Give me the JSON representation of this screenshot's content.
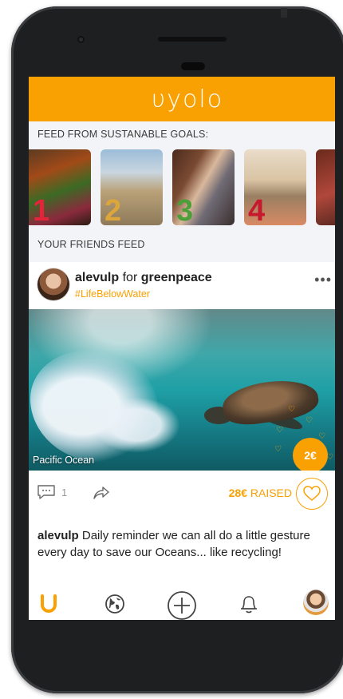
{
  "header": {
    "logo_text": "υyolo"
  },
  "goals_section": {
    "label": "FEED FROM SUSTANABLE GOALS:",
    "goals": [
      {
        "number": "1",
        "color": "#e5243b"
      },
      {
        "number": "2",
        "color": "#dda63a"
      },
      {
        "number": "3",
        "color": "#4c9f38"
      },
      {
        "number": "4",
        "color": "#c5192d"
      },
      {
        "number": "",
        "color": "#ff3a21"
      }
    ]
  },
  "friends_section": {
    "label": "YOUR FRIENDS FEED"
  },
  "post": {
    "username": "alevulp",
    "connector": "for",
    "org": "greenpeace",
    "hashtag": "#LifeBelowWater",
    "more": "•••",
    "photo_caption": "Pacific Ocean",
    "donate_amount": "2€",
    "comment_count": "1",
    "raised_amount": "28€",
    "raised_label": "RAISED",
    "caption_user": "alevulp",
    "caption_text": " Daily reminder we can all do a little gesture every day to save our Oceans... like recycling!"
  },
  "tabbar": {
    "items": [
      "home-icon",
      "globe-icon",
      "add-icon",
      "bell-icon",
      "profile-avatar"
    ]
  },
  "colors": {
    "accent": "#f9a003"
  }
}
